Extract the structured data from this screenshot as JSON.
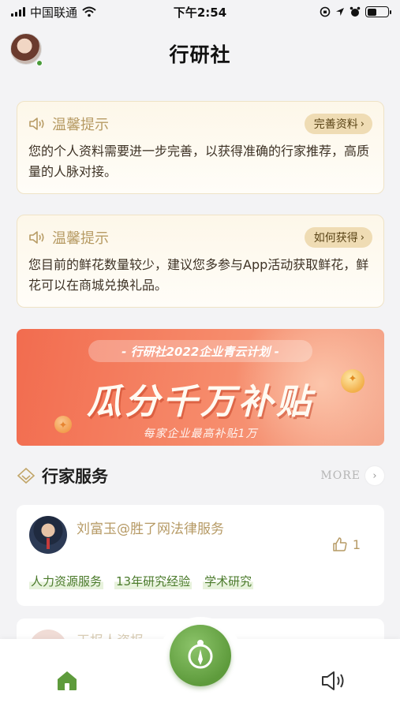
{
  "status_bar": {
    "carrier": "中国联通",
    "time": "下午2:54",
    "battery_level": 0.45
  },
  "header": {
    "title": "行研社"
  },
  "tips": [
    {
      "title": "温馨提示",
      "button_label": "完善资料",
      "text": "您的个人资料需要进一步完善，以获得准确的行家推荐，高质量的人脉对接。"
    },
    {
      "title": "温馨提示",
      "button_label": "如何获得",
      "text": "您目前的鲜花数量较少，建议您多参与App活动获取鲜花，鲜花可以在商城兑换礼品。"
    }
  ],
  "banner": {
    "tag": "- 行研社2022企业青云计划 -",
    "headline": "瓜分千万补贴",
    "subline": "每家企业最高补贴1万"
  },
  "section": {
    "title": "行家服务",
    "more_label": "MORE"
  },
  "service_card": {
    "name": "刘富玉@胜了网法律服务",
    "likes": "1",
    "tags": [
      "人力资源服务",
      "13年研究经验",
      "学术研究"
    ]
  },
  "next_card": {
    "name": "王报人资报"
  },
  "colors": {
    "accent_green": "#5e9b3c",
    "gold_text": "#b69a65",
    "banner_red": "#f26c4f"
  },
  "icons": {
    "tip": "speaker-icon",
    "section": "diamond-icon",
    "like": "thumbs-up-icon",
    "nav_left": "home-icon",
    "nav_center": "compass-icon",
    "nav_right": "megaphone-icon"
  }
}
